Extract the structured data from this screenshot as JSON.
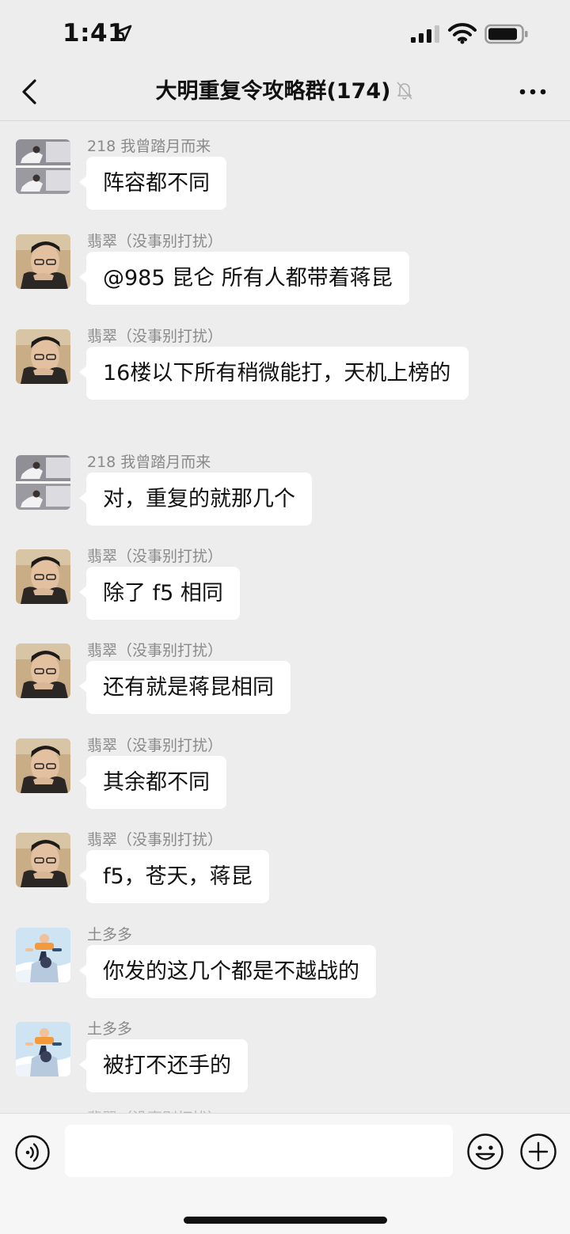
{
  "status_bar": {
    "time": "1:41"
  },
  "header": {
    "title": "大明重复令攻略群(174)"
  },
  "messages": [
    {
      "sender": "218 我曾踏月而来",
      "text": "阵容都不同",
      "avatar": "avatar-218"
    },
    {
      "sender": "翡翠（没事别打扰）",
      "text": "@985 昆仑 所有人都带着蒋昆",
      "avatar": "avatar-feicui"
    },
    {
      "sender": "翡翠（没事别打扰）",
      "text": "16楼以下所有稍微能打，天机上榜的",
      "avatar": "avatar-feicui"
    },
    {
      "sender": "218 我曾踏月而来",
      "text": "对，重复的就那几个",
      "avatar": "avatar-218"
    },
    {
      "sender": "翡翠（没事别打扰）",
      "text": "除了 f5 相同",
      "avatar": "avatar-feicui"
    },
    {
      "sender": "翡翠（没事别打扰）",
      "text": "还有就是蒋昆相同",
      "avatar": "avatar-feicui"
    },
    {
      "sender": "翡翠（没事别打扰）",
      "text": "其余都不同",
      "avatar": "avatar-feicui"
    },
    {
      "sender": "翡翠（没事别打扰）",
      "text": "f5，苍天，蒋昆",
      "avatar": "avatar-feicui"
    },
    {
      "sender": "土多多",
      "text": "你发的这几个都是不越战的",
      "avatar": "avatar-tuduoduo"
    },
    {
      "sender": "土多多",
      "text": "被打不还手的",
      "avatar": "avatar-tuduoduo"
    }
  ],
  "peek_sender": "翡翠（没事别打扰）",
  "input": {
    "value": "",
    "placeholder": ""
  },
  "colors": {
    "background": "#ededed",
    "bubble": "#ffffff",
    "sender": "#8a8a8a"
  },
  "icons": [
    "location-arrow-icon",
    "signal-icon",
    "wifi-icon",
    "battery-icon",
    "back-icon",
    "mute-bell-icon",
    "more-icon",
    "voice-icon",
    "emoji-icon",
    "plus-icon"
  ]
}
